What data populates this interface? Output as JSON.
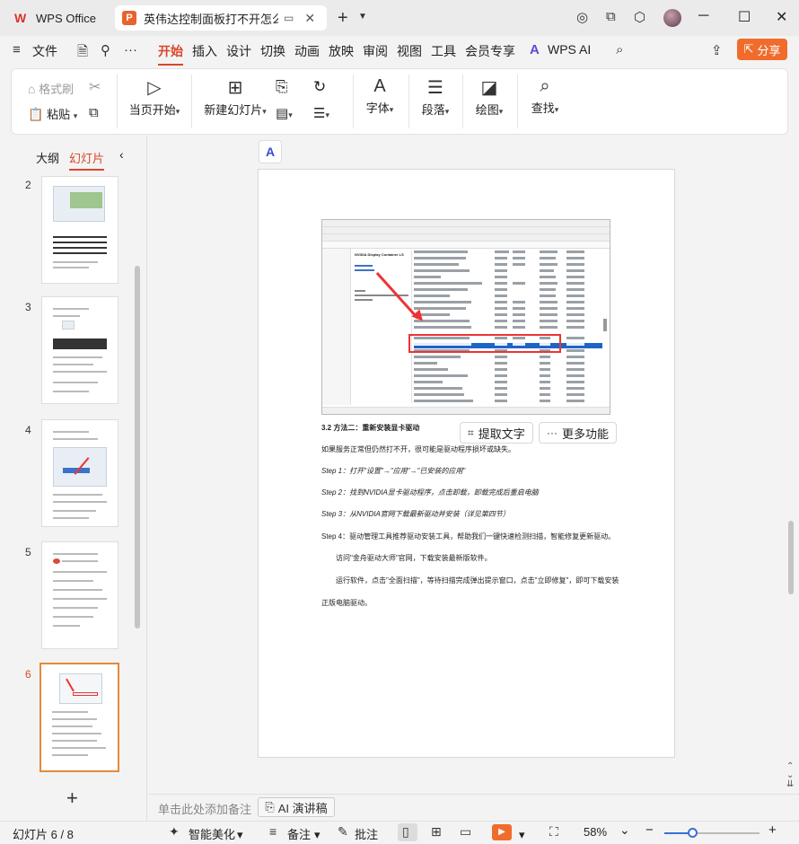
{
  "titlebar": {
    "home_tab": "WPS Office",
    "doc_tab": "英伟达控制面板打不开怎么",
    "win_min": "─",
    "win_max": "☐",
    "win_close": "✕"
  },
  "menu": {
    "file": "文件",
    "items": [
      "开始",
      "插入",
      "设计",
      "切换",
      "动画",
      "放映",
      "审阅",
      "视图",
      "工具",
      "会员专享"
    ],
    "ai": "WPS AI",
    "share": "分享"
  },
  "ribbon": {
    "format_brush": "格式刷",
    "paste": "粘贴",
    "start_from_current": "当页开始",
    "new_slide": "新建幻灯片",
    "font": "字体",
    "paragraph": "段落",
    "drawing": "绘图",
    "find": "查找"
  },
  "left_panel": {
    "tab_outline": "大纲",
    "tab_slides": "幻灯片",
    "slide_numbers": [
      "2",
      "3",
      "4",
      "5",
      "6"
    ],
    "selected": "6"
  },
  "slide": {
    "heading": "3.2 方法二：重新安装显卡驱动",
    "lines": [
      "如果服务正常但仍然打不开，很可能是驱动程序损坏或缺失。",
      "Step 1：打开\"设置\"→\"应用\"→\"已安装的应用\"",
      "Step 2：找到NVIDIA显卡驱动程序，点击卸载，卸载完成后重启电脑",
      "Step 3：从NVIDIA官网下载最新驱动并安装（详见第四节）",
      "Step 4：驱动管理工具推荐驱动安装工具，帮助我们一键快速检测扫描，智能修复更新驱动。",
      "访问\"金舟驱动大师\"官网，下载安装最新版软件。",
      "运行软件，点击\"全面扫描\"，等待扫描完成弹出提示窗口，点击\"立即修复\"，即可下载安装",
      "正版电脑驱动。"
    ],
    "screenshot_title": "NVIDIA Display Container LS"
  },
  "float_buttons": {
    "extract_text": "提取文字",
    "more": "更多功能"
  },
  "notes": {
    "hint": "单击此处添加备注",
    "ai_btn": "AI 演讲稿"
  },
  "status": {
    "slide_count": "幻灯片 6 / 8",
    "beautify": "智能美化",
    "notes": "备注",
    "comments": "批注",
    "zoom": "58%",
    "zoom_fraction": 0.29
  }
}
